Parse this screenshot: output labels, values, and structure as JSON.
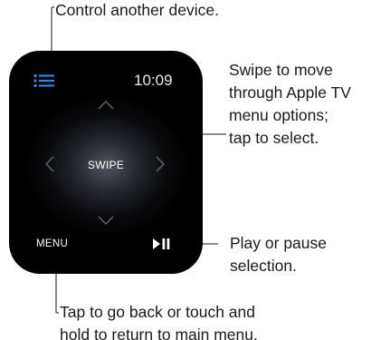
{
  "callouts": {
    "control_device": "Control another device.",
    "swipe_move": "Swipe to move\nthrough Apple TV\nmenu options;\ntap to select.",
    "play_pause": "Play or pause\nselection.",
    "menu_back": "Tap to go back or touch and\nhold to return to main menu."
  },
  "watch": {
    "time": "10:09",
    "swipe_label": "SWIPE",
    "menu_label": "MENU",
    "icons": {
      "device_list": "list-icon",
      "up": "chevron-up-icon",
      "down": "chevron-down-icon",
      "left": "chevron-left-icon",
      "right": "chevron-right-icon",
      "play_pause": "play-pause-icon"
    }
  },
  "colors": {
    "screen": "#000000",
    "accent": "#1e90ff",
    "text": "#1a1a1a"
  }
}
